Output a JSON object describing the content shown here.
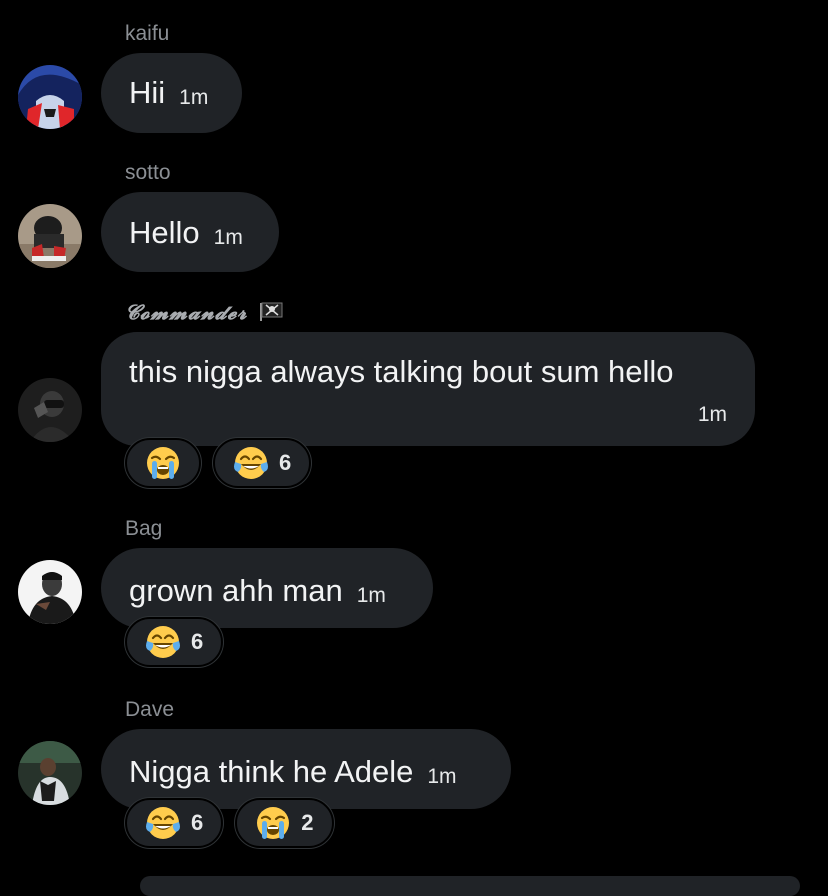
{
  "messages": [
    {
      "sender": "kaifu",
      "text": "Hii",
      "time": "1m",
      "reactions": []
    },
    {
      "sender": "sotto",
      "text": "Hello",
      "time": "1m",
      "reactions": []
    },
    {
      "sender": "𝓒𝓸𝓶𝓶𝓪𝓷𝓭𝓮𝓻",
      "text": "this nigga always talking bout sum hello",
      "time": "1m",
      "reactions": [
        {
          "emoji": "loudly-crying-face",
          "count": ""
        },
        {
          "emoji": "face-with-tears-of-joy",
          "count": "6"
        }
      ]
    },
    {
      "sender": "Bag",
      "text": "grown ahh man",
      "time": "1m",
      "reactions": [
        {
          "emoji": "face-with-tears-of-joy",
          "count": "6"
        }
      ]
    },
    {
      "sender": "Dave",
      "text": "Nigga think he Adele",
      "time": "1m",
      "reactions": [
        {
          "emoji": "face-with-tears-of-joy",
          "count": "6"
        },
        {
          "emoji": "loudly-crying-face",
          "count": "2"
        }
      ]
    }
  ],
  "colors": {
    "background": "#000000",
    "bubble": "#202327",
    "sender": "#8b8f94",
    "text": "#f2f3f4"
  }
}
